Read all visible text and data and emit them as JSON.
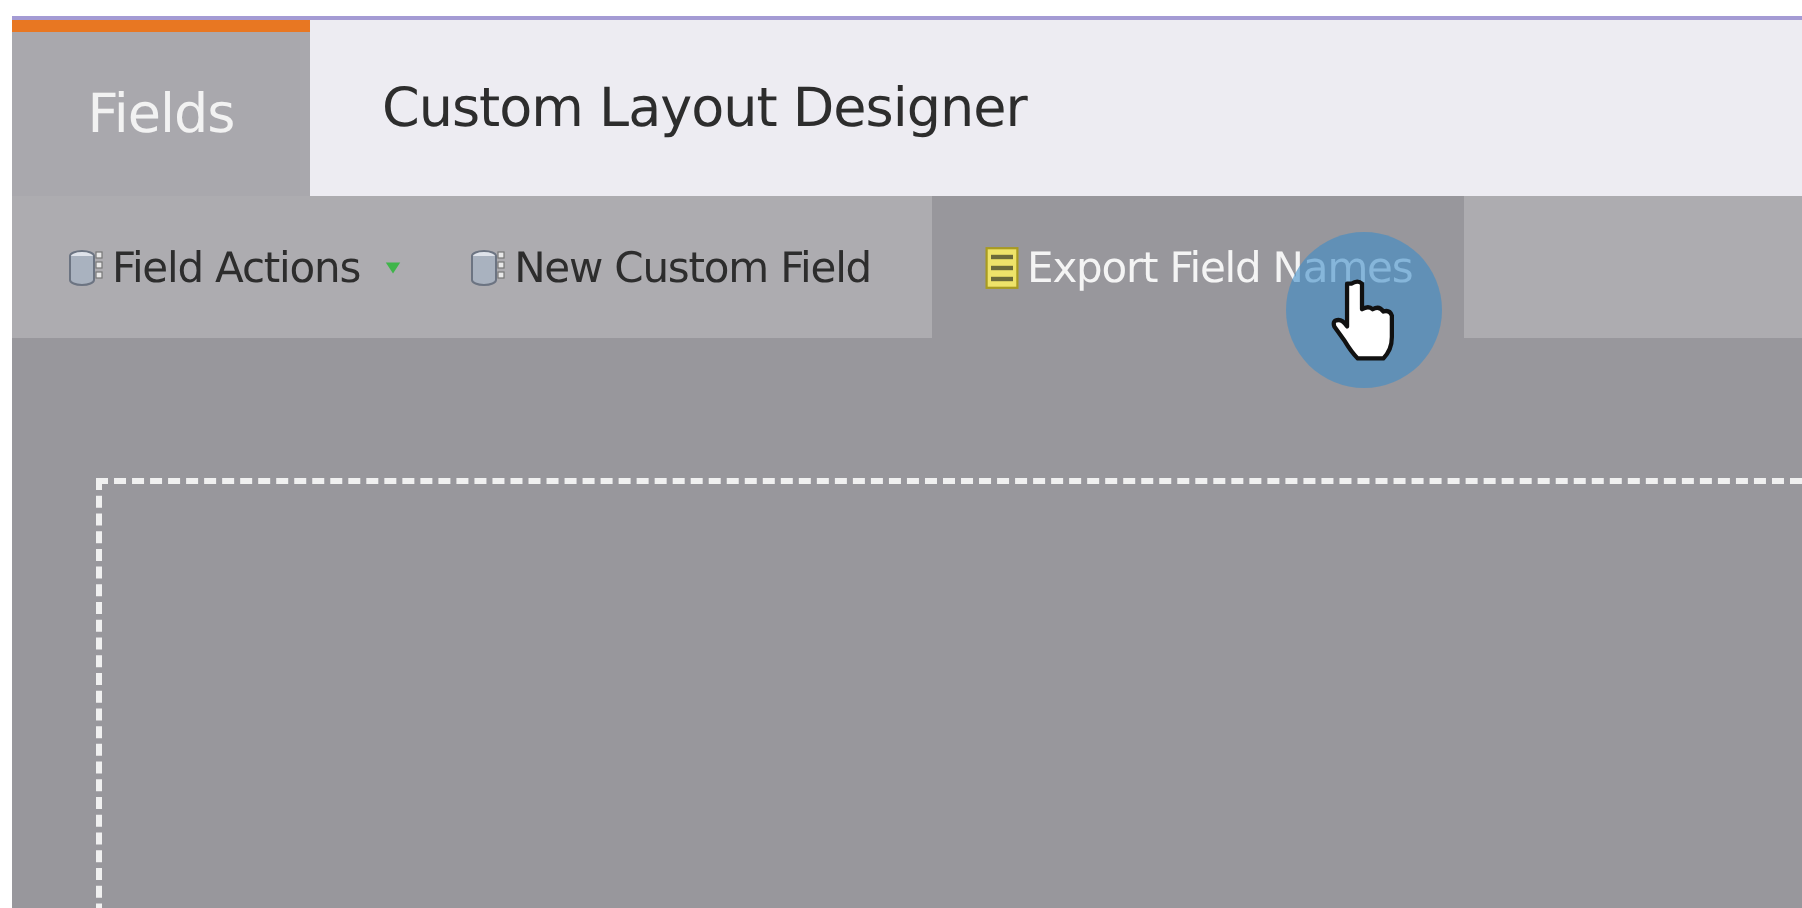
{
  "tabs": [
    {
      "label": "Fields",
      "selected": true
    },
    {
      "label": "Custom Layout Designer",
      "selected": false
    }
  ],
  "toolbar": [
    {
      "label": "Field Actions",
      "kind": "database",
      "has_menu": true,
      "hovered": false
    },
    {
      "label": "New Custom Field",
      "kind": "database",
      "has_menu": false,
      "hovered": false
    },
    {
      "label": "Export Field Names",
      "kind": "sheet",
      "has_menu": false,
      "hovered": true
    }
  ]
}
